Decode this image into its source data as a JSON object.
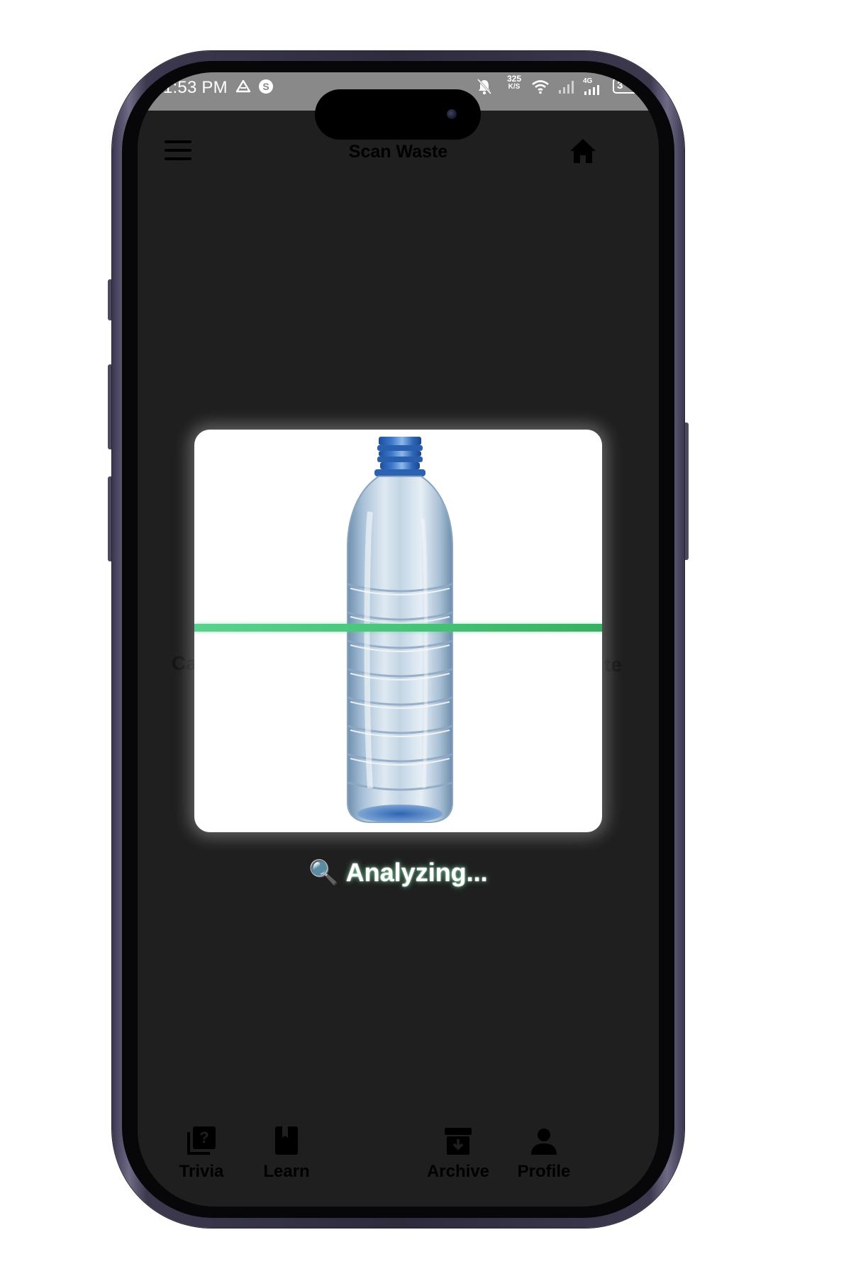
{
  "status_bar": {
    "time": "1:53 PM",
    "net_speed_value": "325",
    "net_speed_unit": "K/S",
    "network_type": "4G",
    "battery": "3"
  },
  "header": {
    "title": "Scan Waste",
    "menu_icon": "hamburger-menu-icon",
    "home_icon": "home-icon"
  },
  "background": {
    "left_text": "Ca",
    "right_text": "te"
  },
  "scan": {
    "status_icon": "🔍",
    "status_text": "Analyzing...",
    "scan_line_color": "#4cc97e",
    "item_image": "plastic-bottle"
  },
  "bottom_nav": {
    "items": [
      {
        "label": "Trivia",
        "icon": "trivia-icon"
      },
      {
        "label": "Learn",
        "icon": "book-icon"
      },
      {
        "label": "Archive",
        "icon": "archive-icon"
      },
      {
        "label": "Profile",
        "icon": "person-icon"
      }
    ]
  }
}
